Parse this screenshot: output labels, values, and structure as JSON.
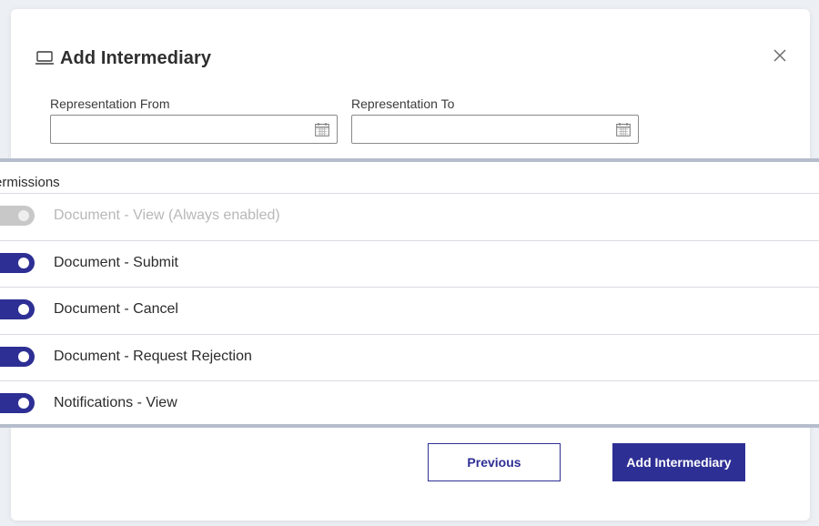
{
  "dialog": {
    "title": "Add Intermediary",
    "icon": "laptop-icon",
    "close_icon": "close-icon"
  },
  "fields": {
    "from": {
      "label": "Representation From",
      "value": "",
      "icon": "calendar-icon"
    },
    "to": {
      "label": "Representation To",
      "value": "",
      "icon": "calendar-icon"
    }
  },
  "permissions": {
    "title": "ermissions",
    "items": [
      {
        "label": "Document - View (Always enabled)",
        "enabled": true,
        "disabled": true
      },
      {
        "label": "Document - Submit",
        "enabled": true,
        "disabled": false
      },
      {
        "label": "Document - Cancel",
        "enabled": true,
        "disabled": false
      },
      {
        "label": "Document - Request Rejection",
        "enabled": true,
        "disabled": false
      },
      {
        "label": "Notifications - View",
        "enabled": true,
        "disabled": false
      }
    ]
  },
  "buttons": {
    "previous": "Previous",
    "add": "Add Intermediary"
  },
  "colors": {
    "accent": "#2e2f94",
    "toggle_disabled": "#c8c8c8",
    "panel_border": "#b5bdcc"
  }
}
